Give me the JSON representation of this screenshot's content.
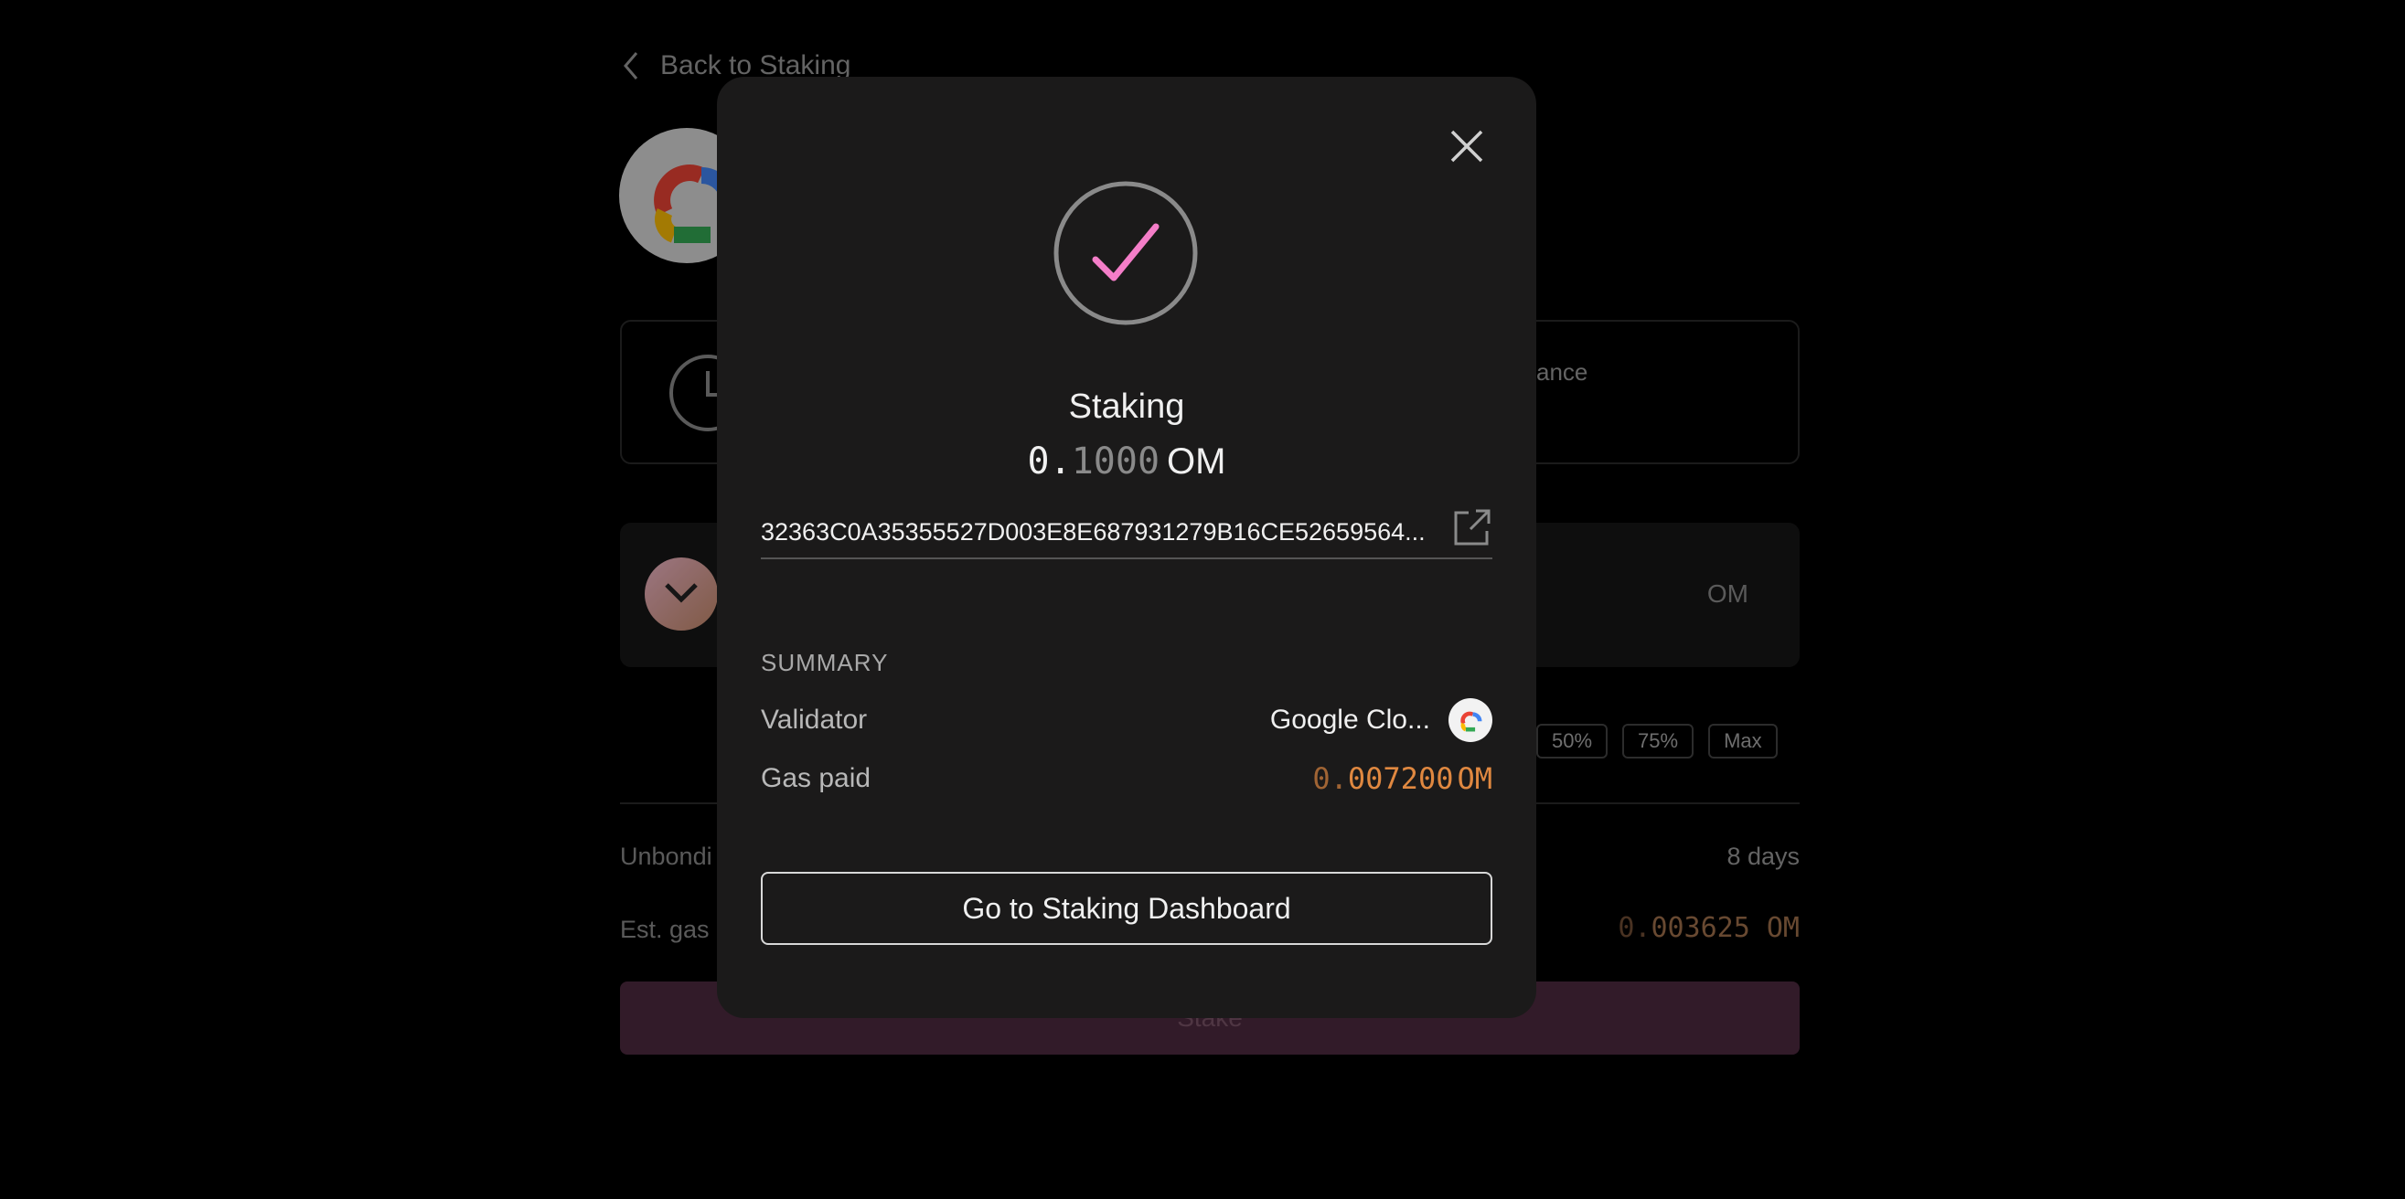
{
  "background": {
    "back_link_label": "Back to Staking",
    "balance_label": "ance",
    "amount_unit": "OM",
    "percent_buttons": [
      "50%",
      "75%",
      "Max"
    ],
    "unbonding_label": "Unbondi",
    "unbonding_value": "8 days",
    "est_gas_label": "Est. gas",
    "est_gas_value_int": "0.",
    "est_gas_value_frac": "003625",
    "est_gas_unit": "OM",
    "stake_button_label": "Stake"
  },
  "modal": {
    "title": "Staking",
    "amount_int": "0.",
    "amount_frac": "1000",
    "amount_unit": "OM",
    "tx_hash": "32363C0A35355527D003E8E687931279B16CE52659564...",
    "summary_heading": "SUMMARY",
    "validator_label": "Validator",
    "validator_value": "Google Clo...",
    "gas_label": "Gas paid",
    "gas_int": "0.",
    "gas_frac": "007200",
    "gas_unit": "OM",
    "dashboard_button_label": "Go to Staking Dashboard"
  },
  "colors": {
    "accent_pink": "#f47ec8",
    "gas_orange": "#e08840",
    "modal_bg": "#1b1a1a"
  },
  "icons": {
    "close": "close-icon",
    "success": "check-circle-icon",
    "external_link": "external-link-icon",
    "validator_logo": "google-cloud-icon"
  }
}
